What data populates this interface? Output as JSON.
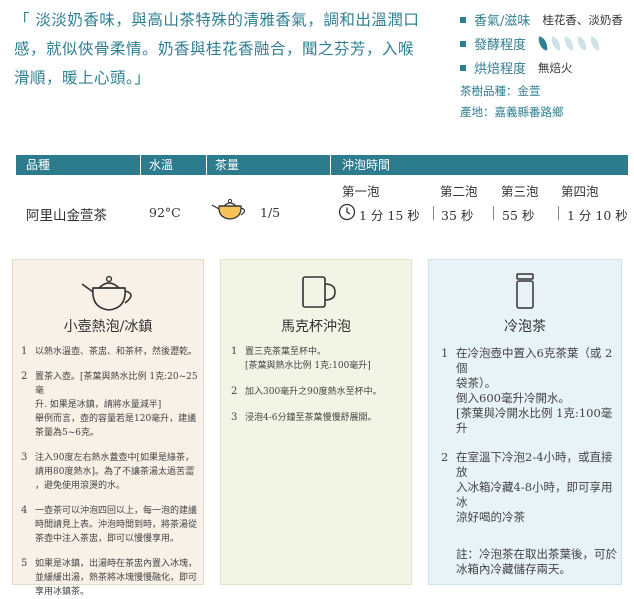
{
  "intro": {
    "quote_lines": [
      "「 淡淡奶香味，與高山茶特殊的清雅香氣，調和出溫潤口",
      "感，就似俠骨柔情。奶香與桂花香融合，聞之芬芳，入喉",
      "滑順，暖上心頭。」"
    ]
  },
  "attributes": {
    "aroma_label": "香氣/滋味",
    "aroma_value": "桂花香、淡奶香",
    "ferment_label": "發酵程度",
    "ferment_level": 1,
    "ferment_max": 5,
    "roast_label": "烘焙程度",
    "roast_value": "無焙火",
    "variety": "茶樹品種：金萱",
    "origin": "產地：嘉義縣番路鄉",
    "accent_color": "#2f7f92",
    "leaf_off_color": "#cde3e8"
  },
  "brew_table": {
    "headers": [
      "品種",
      "水溫",
      "茶量",
      "沖泡時間"
    ],
    "steep_labels": [
      "第一泡",
      "第二泡",
      "第三泡",
      "第四泡"
    ],
    "variety": "阿里山金萱茶",
    "water_temp": "92°C",
    "amount": "1/5",
    "steep_times": [
      "1 分 15 秒",
      "35 秒",
      "55 秒",
      "1 分 10 秒"
    ],
    "header_color": "#2c7c8e"
  },
  "methods": [
    {
      "title": "小壺熱泡/冰鎮",
      "icon": "teapot-icon",
      "steps": [
        {
          "n": "1",
          "lines": [
            "以熱水溫壺、茶盅、和茶杯，然後瀝乾。"
          ]
        },
        {
          "n": "2",
          "lines": [
            "置茶入壺。[茶葉與熱水比例 1克:20~25毫",
            "升. 如果是冰鎮，請將水量減半]",
            "舉例而言，壺的容量若是120毫升，建議",
            "茶量為5~6克。"
          ]
        },
        {
          "n": "3",
          "lines": [
            "注入90度左右熱水蓋壺中[如果是綠茶，",
            "請用80度熱水]。為了不讓茶湯太過苦澀",
            "，避免使用滾燙的水。"
          ]
        },
        {
          "n": "4",
          "lines": [
            "一壺茶可以沖泡四回以上，每一泡的建議",
            "時間請見上表。沖泡時間到時，將茶湯從",
            "茶壺中注入茶盅，即可以慢慢享用。"
          ]
        },
        {
          "n": "5",
          "lines": [
            "如果是冰鎮，出湯時在茶盅內置入冰塊，",
            "並緩緩出湯，熱茶將冰塊慢慢融化，即可",
            "享用冰鎮茶。"
          ]
        }
      ]
    },
    {
      "title": "馬克杯沖泡",
      "icon": "mug-icon",
      "steps": [
        {
          "n": "1",
          "lines": [
            "置三克茶葉至杯中。",
            "[茶葉與熱水比例 1克:100毫升]"
          ]
        },
        {
          "n": "2",
          "lines": [
            "加入300毫升之90度熱水至杯中。"
          ]
        },
        {
          "n": "3",
          "lines": [
            "浸泡4-6分鐘至茶葉慢慢舒展開。"
          ]
        }
      ]
    },
    {
      "title": "冷泡茶",
      "icon": "bottle-icon",
      "steps": [
        {
          "n": "1",
          "lines": [
            "在冷泡壺中置入6克茶葉（或 2個",
            "袋茶）。",
            "倒入600毫升冷開水。",
            "[茶葉與冷開水比例 1克:100毫升"
          ]
        },
        {
          "n": "2",
          "lines": [
            "在室溫下冷泡2-4小時，或直接放",
            "入冰箱冷藏4-8小時，即可享用冰",
            "涼好喝的冷茶"
          ]
        }
      ],
      "note_lines": [
        "註：冷泡茶在取出茶葉後，可於",
        "冰箱內冷藏儲存兩天。"
      ]
    }
  ]
}
